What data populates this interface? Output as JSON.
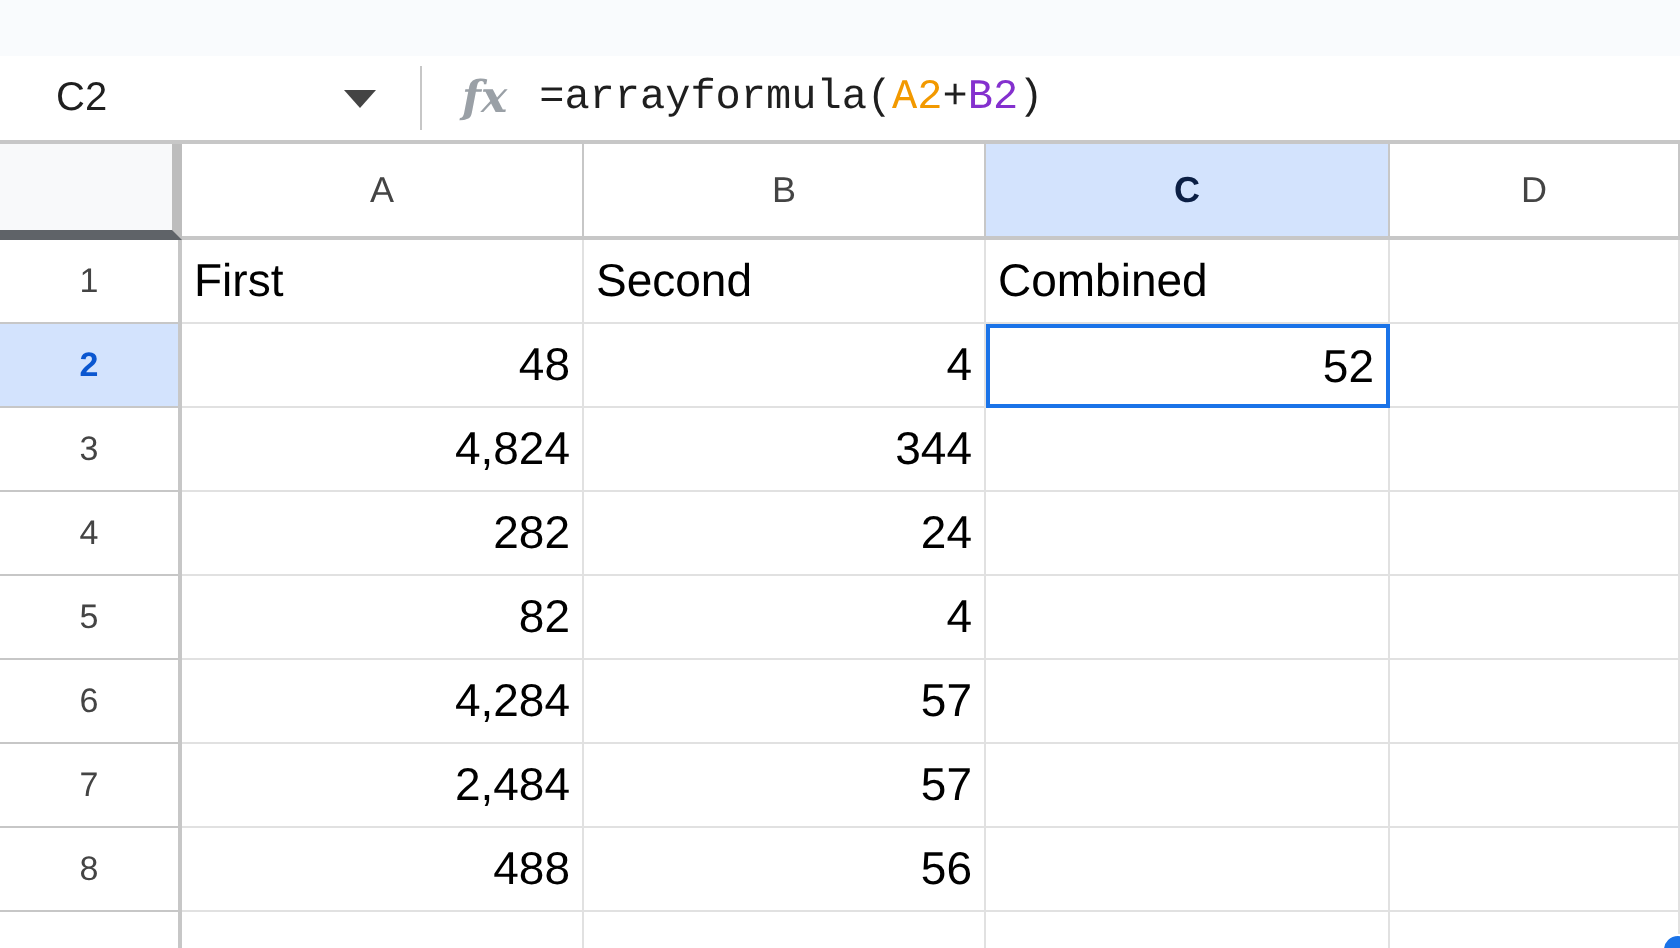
{
  "name_box": {
    "value": "C2"
  },
  "formula_bar": {
    "function_icon": "fx",
    "parts": [
      {
        "text": "=arrayformula(",
        "kind": "plain"
      },
      {
        "text": "A2",
        "kind": "ref",
        "color": "#f29900"
      },
      {
        "text": "+",
        "kind": "plain"
      },
      {
        "text": "B2",
        "kind": "ref",
        "color": "#8430ce"
      },
      {
        "text": ")",
        "kind": "plain"
      }
    ]
  },
  "columns": [
    {
      "label": "A",
      "selected": false
    },
    {
      "label": "B",
      "selected": false
    },
    {
      "label": "C",
      "selected": true
    },
    {
      "label": "D",
      "selected": false
    }
  ],
  "rows": [
    {
      "number": "1",
      "selected": false,
      "cells": [
        {
          "text": "First",
          "kind": "text",
          "selected": false
        },
        {
          "text": "Second",
          "kind": "text",
          "selected": false
        },
        {
          "text": "Combined",
          "kind": "text",
          "selected": false
        },
        {
          "kind": "empty",
          "selected": false
        }
      ]
    },
    {
      "number": "2",
      "selected": true,
      "cells": [
        {
          "text": "48",
          "kind": "number",
          "selected": false
        },
        {
          "text": "4",
          "kind": "number",
          "selected": false
        },
        {
          "text": "52",
          "kind": "number",
          "selected": true
        },
        {
          "kind": "empty",
          "selected": false
        }
      ]
    },
    {
      "number": "3",
      "selected": false,
      "cells": [
        {
          "text": "4,824",
          "kind": "number",
          "selected": false
        },
        {
          "text": "344",
          "kind": "number",
          "selected": false
        },
        {
          "kind": "empty",
          "selected": false
        },
        {
          "kind": "empty",
          "selected": false
        }
      ]
    },
    {
      "number": "4",
      "selected": false,
      "cells": [
        {
          "text": "282",
          "kind": "number",
          "selected": false
        },
        {
          "text": "24",
          "kind": "number",
          "selected": false
        },
        {
          "kind": "empty",
          "selected": false
        },
        {
          "kind": "empty",
          "selected": false
        }
      ]
    },
    {
      "number": "5",
      "selected": false,
      "cells": [
        {
          "text": "82",
          "kind": "number",
          "selected": false
        },
        {
          "text": "4",
          "kind": "number",
          "selected": false
        },
        {
          "kind": "empty",
          "selected": false
        },
        {
          "kind": "empty",
          "selected": false
        }
      ]
    },
    {
      "number": "6",
      "selected": false,
      "cells": [
        {
          "text": "4,284",
          "kind": "number",
          "selected": false
        },
        {
          "text": "57",
          "kind": "number",
          "selected": false
        },
        {
          "kind": "empty",
          "selected": false
        },
        {
          "kind": "empty",
          "selected": false
        }
      ]
    },
    {
      "number": "7",
      "selected": false,
      "cells": [
        {
          "text": "2,484",
          "kind": "number",
          "selected": false
        },
        {
          "text": "57",
          "kind": "number",
          "selected": false
        },
        {
          "kind": "empty",
          "selected": false
        },
        {
          "kind": "empty",
          "selected": false
        }
      ]
    },
    {
      "number": "8",
      "selected": false,
      "cells": [
        {
          "text": "488",
          "kind": "number",
          "selected": false
        },
        {
          "text": "56",
          "kind": "number",
          "selected": false
        },
        {
          "kind": "empty",
          "selected": false
        },
        {
          "kind": "empty",
          "selected": false
        }
      ]
    }
  ]
}
